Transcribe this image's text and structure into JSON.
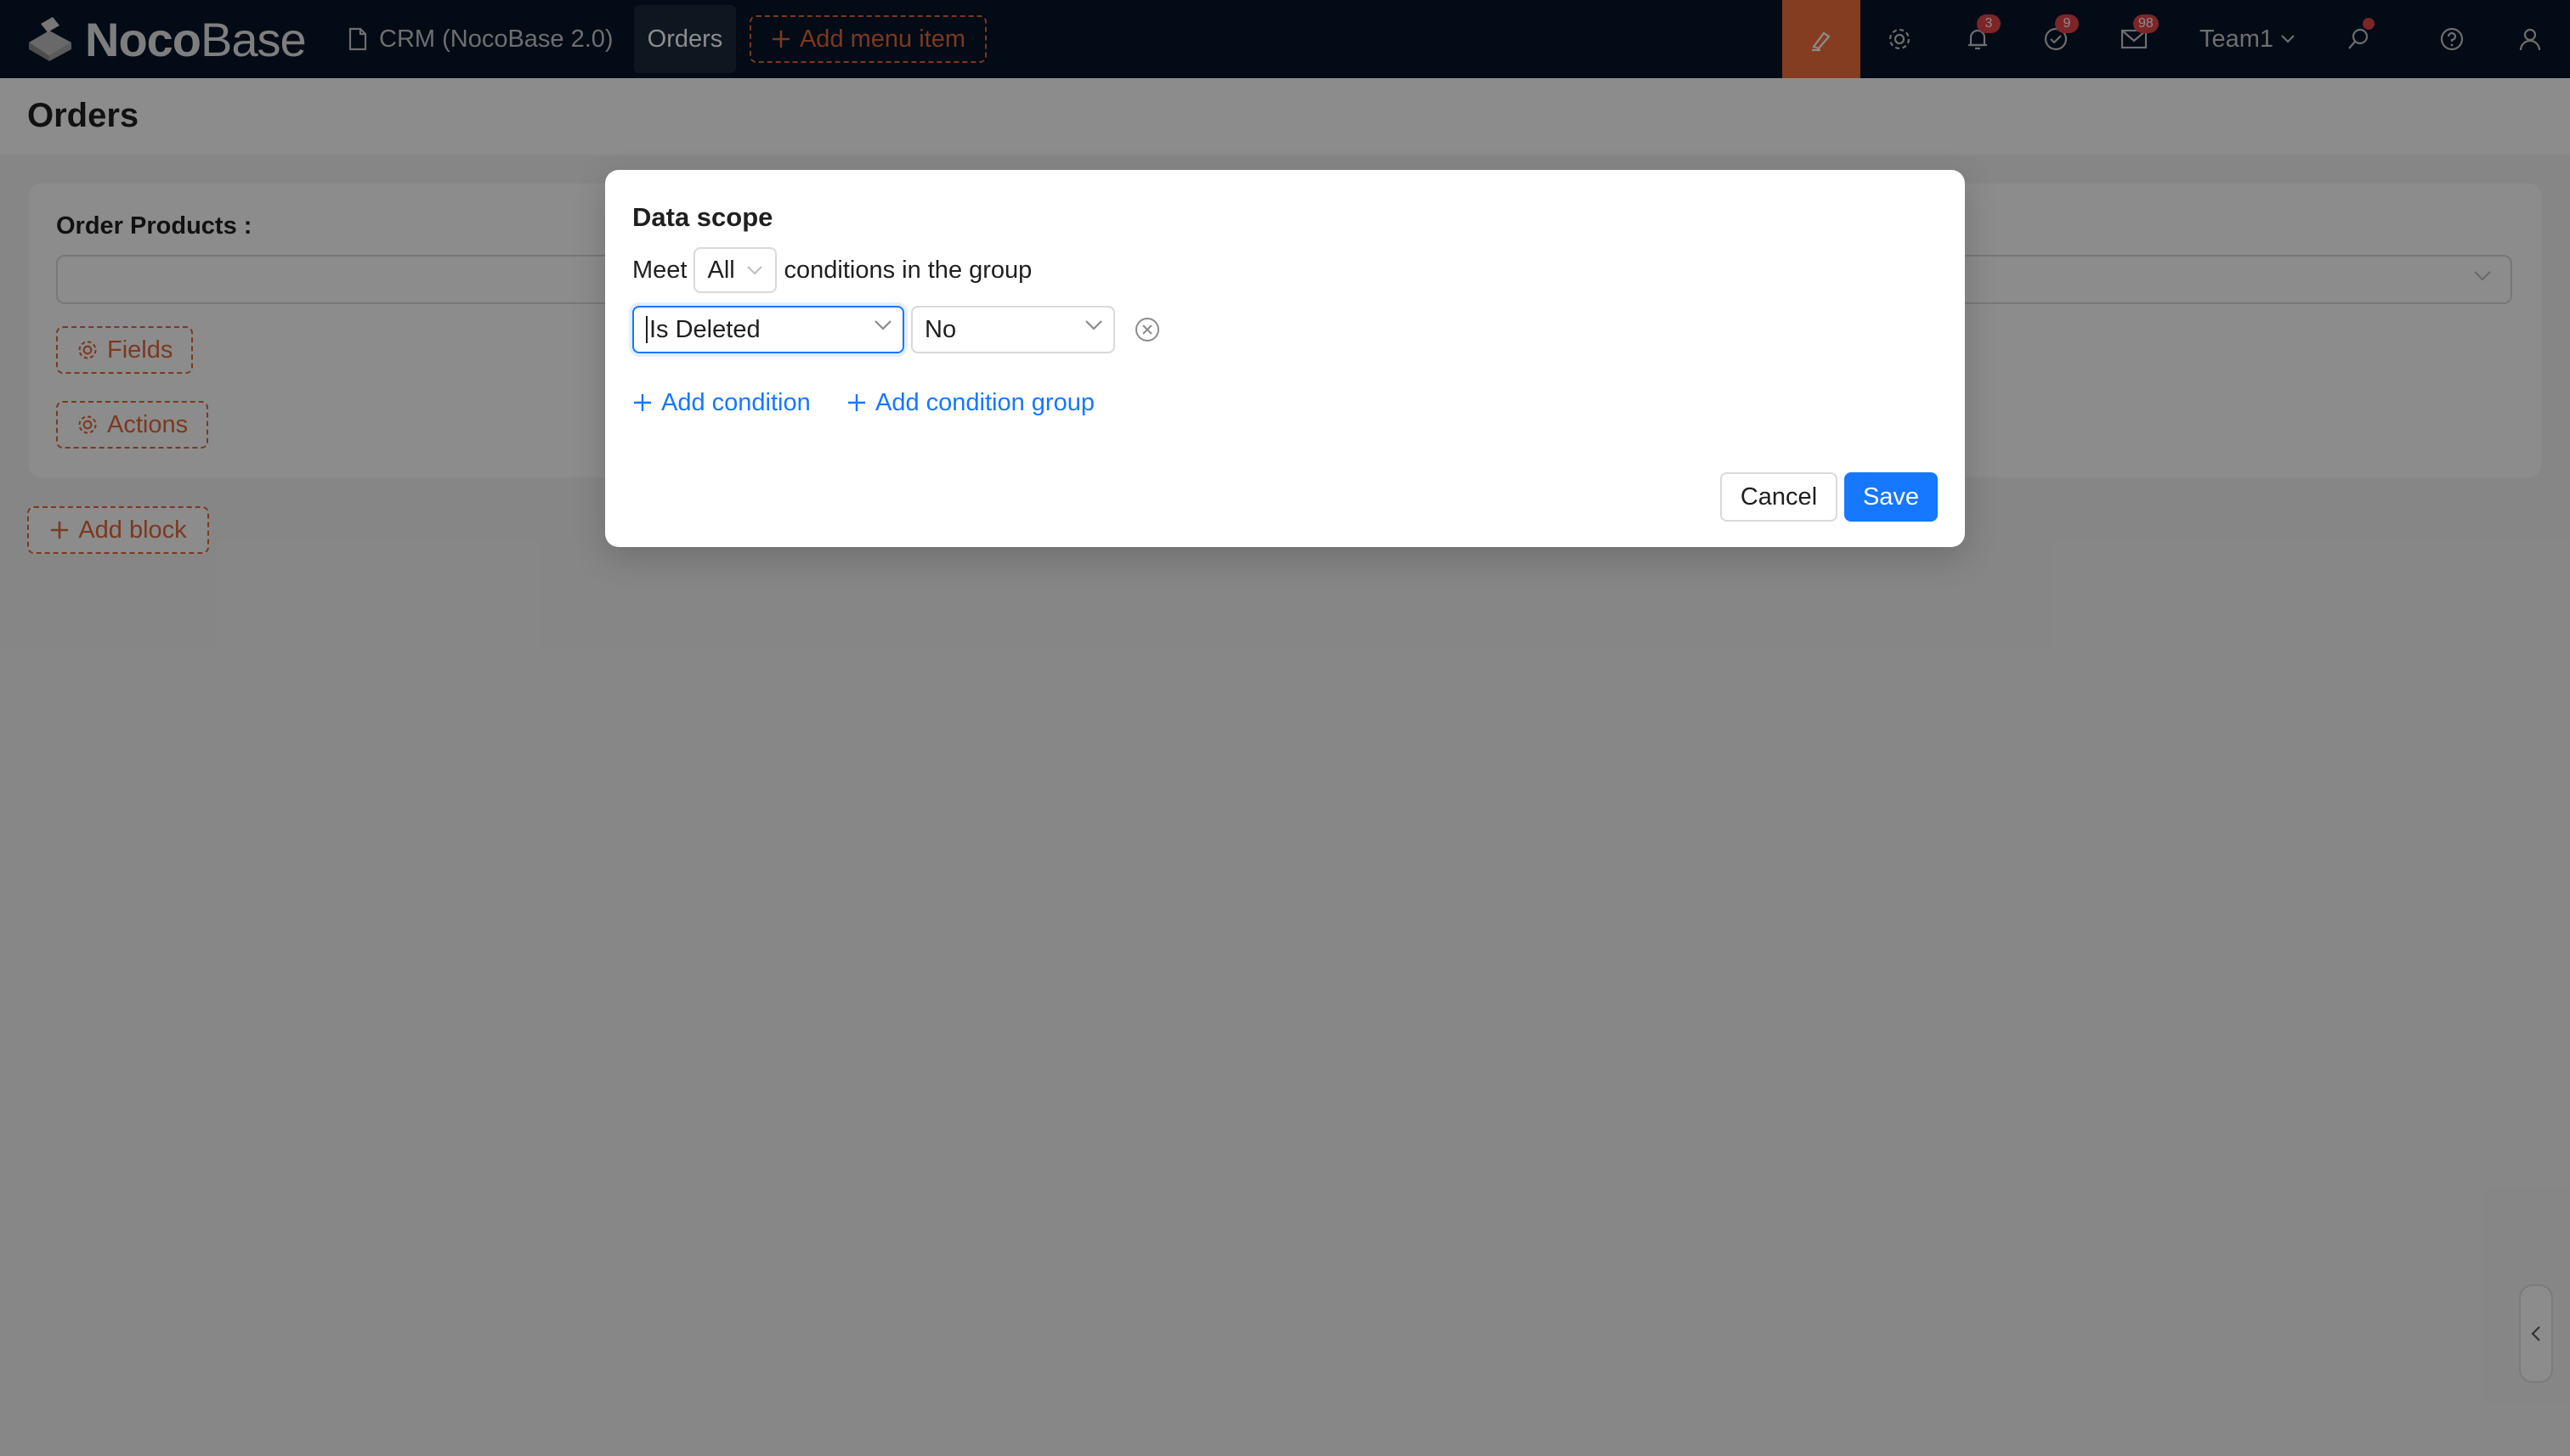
{
  "brand": {
    "name_bold": "Noco",
    "name_light": "Base"
  },
  "nav": {
    "app_label": "CRM (NocoBase 2.0)",
    "active_tab": "Orders",
    "add_menu_item": "Add menu item"
  },
  "toolbar": {
    "notifications_count": "3",
    "tasks_count": "9",
    "messages_count": "98",
    "team_label": "Team1"
  },
  "page": {
    "title": "Orders",
    "field_label": "Order Products :",
    "fields_button": "Fields",
    "actions_button": "Actions",
    "add_block_button": "Add block"
  },
  "modal": {
    "title": "Data scope",
    "meet_prefix": "Meet",
    "meet_value": "All",
    "meet_suffix": "conditions in the group",
    "condition": {
      "field": "Is Deleted",
      "value": "No"
    },
    "add_condition": "Add condition",
    "add_condition_group": "Add condition group",
    "cancel": "Cancel",
    "save": "Save"
  },
  "colors": {
    "accent": "#e0693b",
    "primary": "#1677ff",
    "navbar": "#041528",
    "badge": "#e2454a"
  },
  "icons": [
    "nocobase-logo-icon",
    "file-icon",
    "plus-icon",
    "brush-icon",
    "gear-icon",
    "bell-icon",
    "check-circle-icon",
    "mail-icon",
    "chevron-down-icon",
    "search-icon",
    "question-icon",
    "user-icon",
    "close-circle-icon",
    "chevron-left-icon"
  ]
}
